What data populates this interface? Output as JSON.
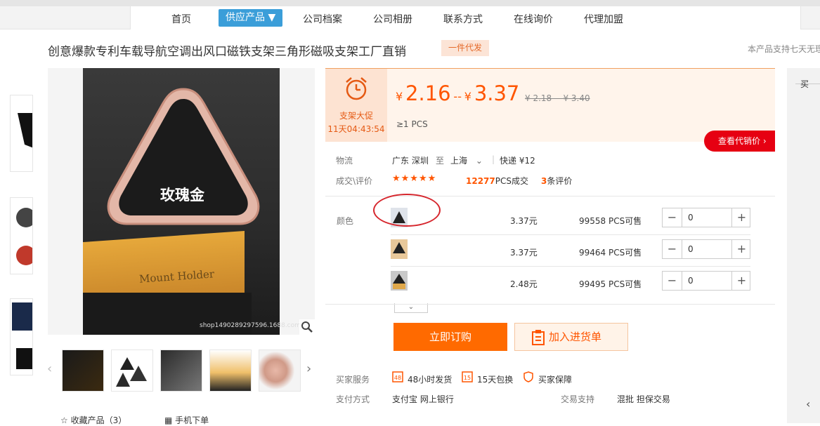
{
  "nav": {
    "items": [
      "首页",
      "供应产品 ▼",
      "公司档案",
      "公司相册",
      "联系方式",
      "在线询价",
      "代理加盟"
    ]
  },
  "product": {
    "title": "创意爆款专利车载导航空调出风口磁铁支架三角形磁吸支架工厂直销",
    "tag": "一件代发",
    "right_note": "本产品支持七天无理",
    "image_text": "玫瑰金",
    "box_text": "Mount Holder",
    "watermark": "shop1490289297596.1688.com"
  },
  "promo": {
    "label": "支架大促",
    "countdown": "11天04:43:54"
  },
  "price": {
    "currency": "¥",
    "low": "2.16",
    "separator": "--",
    "high": "3.37",
    "original": "¥ 2.18 -- ¥ 3.40",
    "moq": "≥1  PCS",
    "dealer_button": "查看代销价"
  },
  "logistics": {
    "label": "物流",
    "from": "广东 深圳",
    "to_word": "至",
    "to": "上海",
    "express": "快递 ¥12"
  },
  "reviews": {
    "label": "成交\\评价",
    "stars": "★★★★★",
    "deals_count": "12277",
    "deals_suffix": "PCS成交",
    "review_count": "3",
    "review_suffix": "条评价"
  },
  "sku": {
    "label": "颜色",
    "rows": [
      {
        "price": "3.37元",
        "stock": "99558 PCS可售",
        "qty": "0"
      },
      {
        "price": "3.37元",
        "stock": "99464 PCS可售",
        "qty": "0"
      },
      {
        "price": "2.48元",
        "stock": "99495 PCS可售",
        "qty": "0"
      }
    ],
    "minus": "−",
    "plus": "+",
    "expand": "⌄"
  },
  "actions": {
    "order": "立即订购",
    "cart": "加入进货单"
  },
  "services": {
    "label": "买家服务",
    "items": [
      "48小时发货",
      "15天包换",
      "买家保障"
    ]
  },
  "payment": {
    "label": "支付方式",
    "methods": "支付宝  网上银行",
    "trade_label": "交易支持",
    "trade_methods": "混批  担保交易"
  },
  "bottom": {
    "favorite": "收藏产品（3）",
    "mobile": "手机下单"
  },
  "sidebar": {
    "label": "买"
  },
  "colors": {
    "accent": "#ff5500",
    "nav_active": "#3b9ed9",
    "dealer": "#e60012"
  }
}
